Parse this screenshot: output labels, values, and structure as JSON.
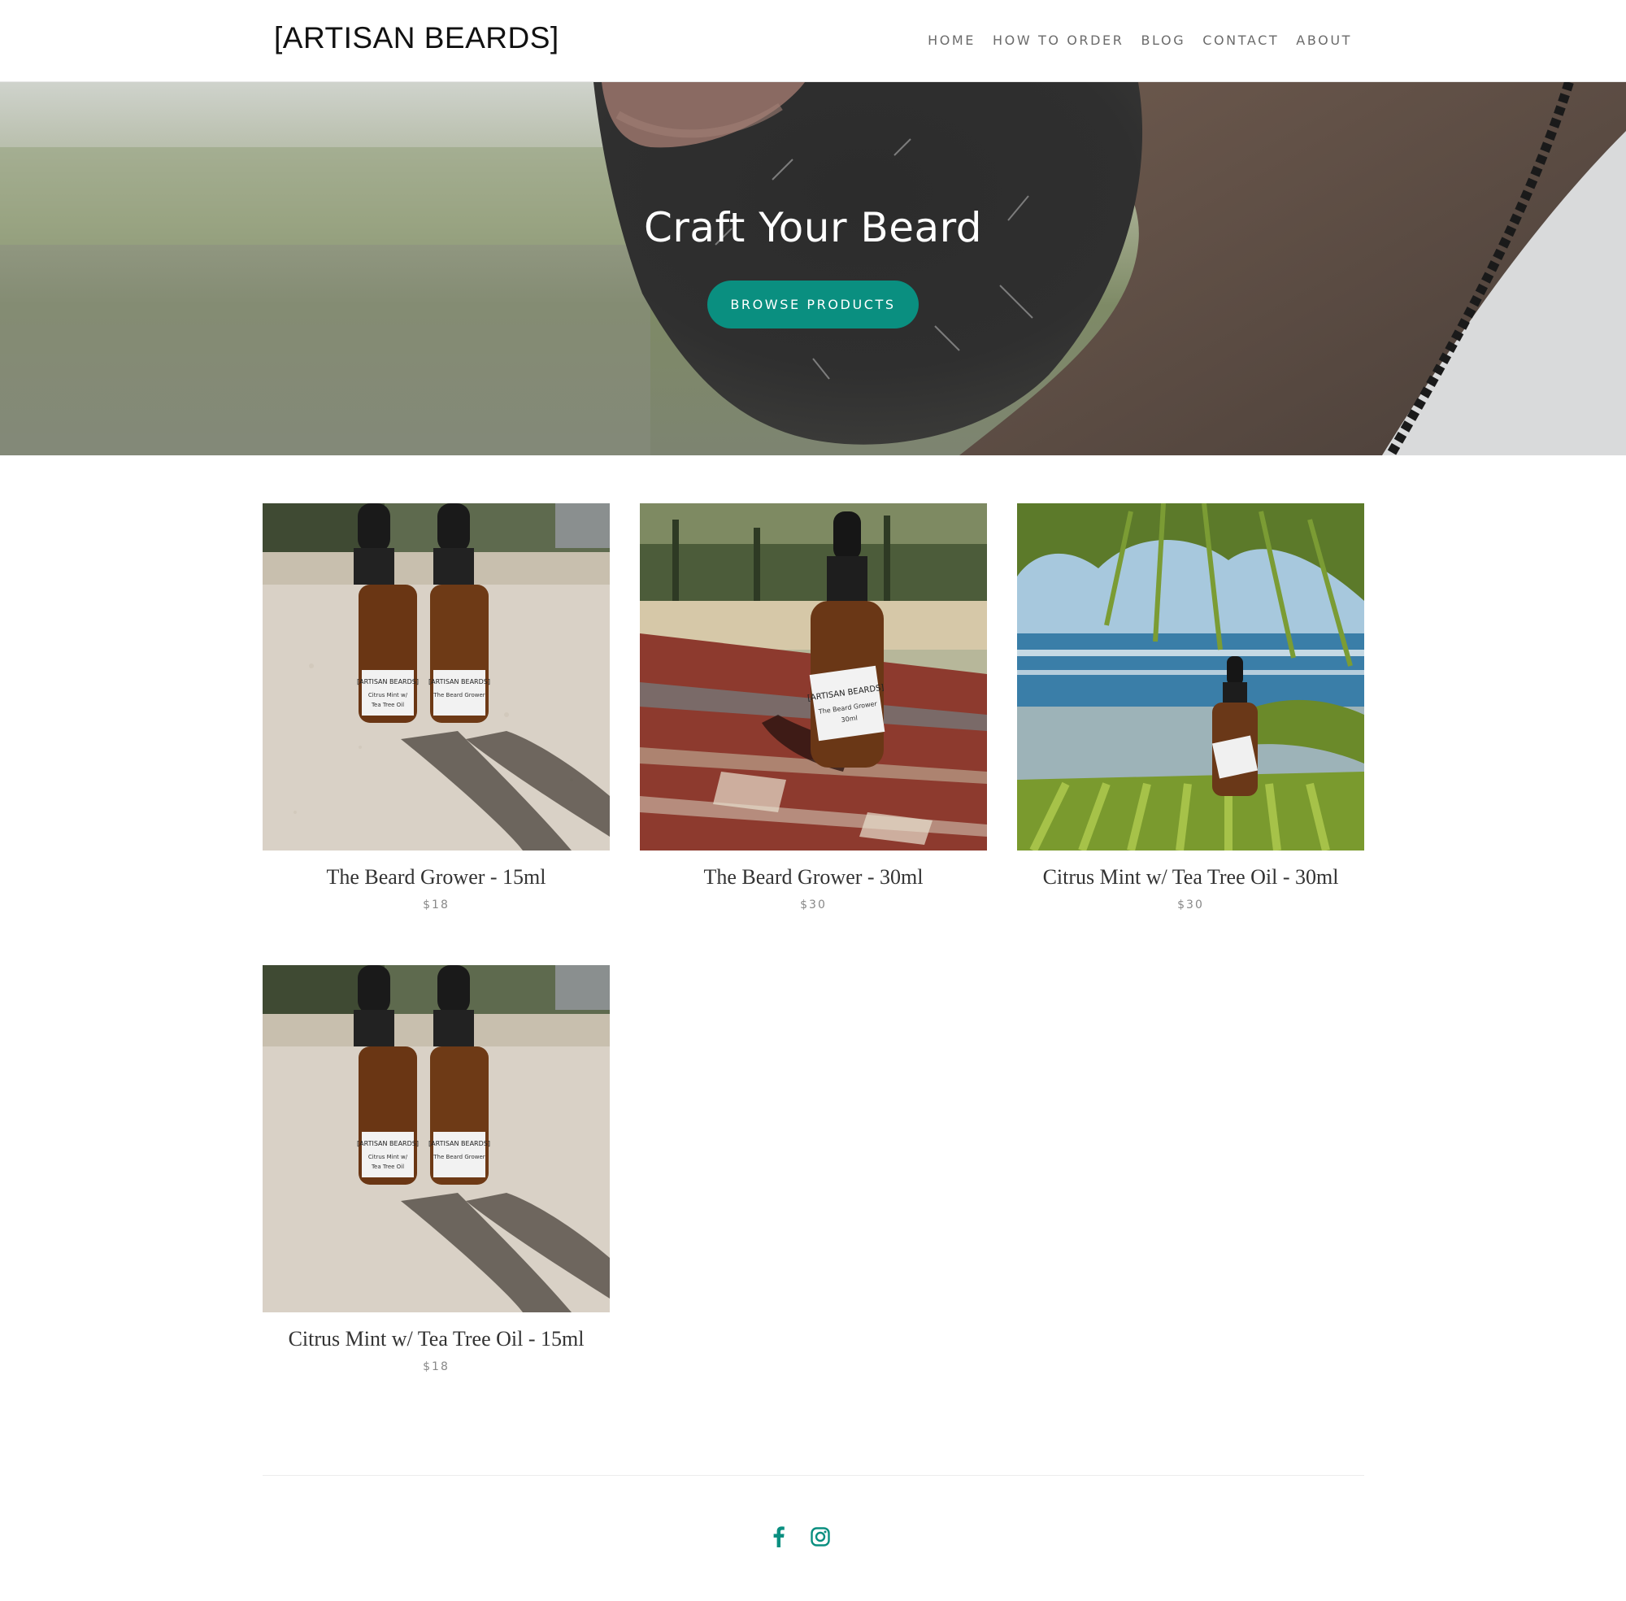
{
  "header": {
    "logo": "[ARTISAN BEARDS]",
    "nav": [
      "HOME",
      "HOW TO ORDER",
      "BLOG",
      "CONTACT",
      "ABOUT"
    ]
  },
  "hero": {
    "title": "Craft Your Beard",
    "button_label": "BROWSE PRODUCTS"
  },
  "products": [
    {
      "name": "The Beard Grower - 15ml",
      "price": "$18",
      "label_line1": "[ARTISAN BEARDS]",
      "label_line2": "Citrus Mint w/",
      "label_line3": "Tea Tree Oil"
    },
    {
      "name": "The Beard Grower - 30ml",
      "price": "$30",
      "label_line1": "[ARTISAN BEARDS]",
      "label_line2": "The Beard Grower",
      "label_line3": "30ml"
    },
    {
      "name": "Citrus Mint w/ Tea Tree Oil - 30ml",
      "price": "$30"
    },
    {
      "name": "Citrus Mint w/ Tea Tree Oil - 15ml",
      "price": "$18"
    }
  ],
  "footer": {
    "social": [
      "facebook-icon",
      "instagram-icon"
    ]
  },
  "colors": {
    "accent": "#0a8f80",
    "nav_text": "#6b6b6b",
    "price_text": "#888888"
  }
}
